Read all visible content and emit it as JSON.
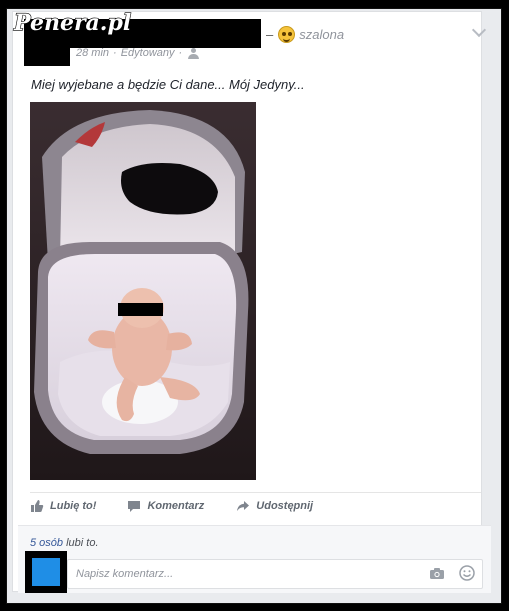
{
  "watermark": {
    "text": "Penera.pl"
  },
  "post": {
    "feeling_label": "szalona",
    "time": "28 min",
    "edited_label": "Edytowany",
    "text": "Miej wyjebane a będzie Ci dane... Mój Jedyny..."
  },
  "actions": {
    "like_label": "Lubię to!",
    "comment_label": "Komentarz",
    "share_label": "Udostępnij"
  },
  "likes": {
    "count_text": "5 osób",
    "suffix": "lubi to."
  },
  "comment": {
    "placeholder": "Napisz komentarz..."
  },
  "colors": {
    "background": "#000000",
    "card": "#ffffff",
    "muted_text": "#90949c",
    "link": "#365899",
    "avatar_blue": "#1f8ee6"
  },
  "icons": [
    "feeling-smiley-icon",
    "chevron-down-icon",
    "friends-icon",
    "like-icon",
    "comment-icon",
    "share-icon",
    "camera-icon",
    "smile-icon"
  ]
}
